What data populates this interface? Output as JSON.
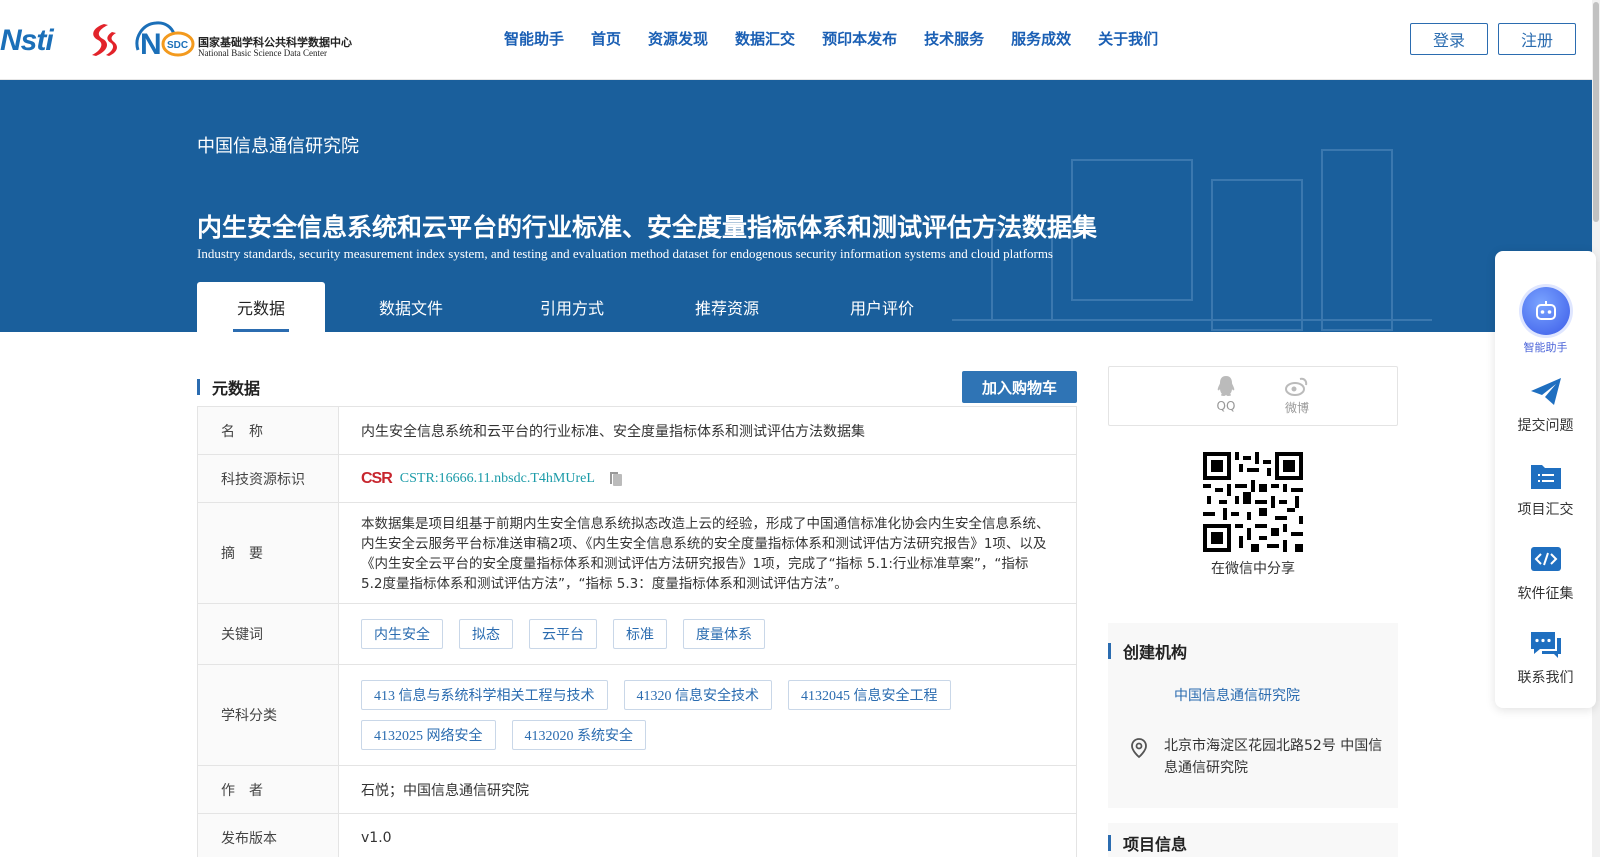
{
  "header": {
    "logo_nsti": "Nsti",
    "logo_nsdc_cn": "国家基础学科公共科学数据中心",
    "logo_nsdc_en": "National Basic Science Data Center",
    "logo_nsdc_mark": "NSDC",
    "nav": [
      "智能助手",
      "首页",
      "资源发现",
      "数据汇交",
      "预印本发布",
      "技术服务",
      "服务成效",
      "关于我们"
    ],
    "login_label": "登录",
    "register_label": "注册"
  },
  "banner": {
    "org": "中国信息通信研究院",
    "title": "内生安全信息系统和云平台的行业标准、安全度量指标体系和测试评估方法数据集",
    "subtitle": "Industry standards, security measurement index system, and testing and evaluation method dataset for endogenous security information systems and cloud platforms",
    "tabs": [
      "元数据",
      "数据文件",
      "引用方式",
      "推荐资源",
      "用户评价"
    ],
    "active_tab": "元数据"
  },
  "metadata": {
    "section_title": "元数据",
    "cart_label": "加入购物车",
    "labels": {
      "name": "名　称",
      "cstr": "科技资源标识",
      "abstract": "摘　要",
      "keywords": "关键词",
      "subjects": "学科分类",
      "author": "作　者",
      "version": "发布版本"
    },
    "name": "内生安全信息系统和云平台的行业标准、安全度量指标体系和测试评估方法数据集",
    "cstr_logo": "CSR",
    "cstr": "CSTR:16666.11.nbsdc.T4hMUreL",
    "abstract": "本数据集是项目组基于前期内生安全信息系统拟态改造上云的经验，形成了中国通信标准化协会内生安全信息系统、内生安全云服务平台标准送审稿2项、《内生安全信息系统的安全度量指标体系和测试评估方法研究报告》1项、以及《内生安全云平台的安全度量指标体系和测试评估方法研究报告》1项，完成了“指标 5.1:行业标准草案”，“指标 5.2度量指标体系和测试评估方法”，“指标 5.3：度量指标体系和测试评估方法”。",
    "keywords": [
      "内生安全",
      "拟态",
      "云平台",
      "标准",
      "度量体系"
    ],
    "subjects": [
      "413 信息与系统科学相关工程与技术",
      "41320 信息安全技术",
      "4132045 信息安全工程",
      "4132025 网络安全",
      "4132020 系统安全"
    ],
    "author": "石悦；中国信息通信研究院",
    "version": "v1.0"
  },
  "share": {
    "qq_label": "QQ",
    "weibo_label": "微博",
    "qr_caption": "在微信中分享"
  },
  "institution": {
    "title": "创建机构",
    "name": "中国信息通信研究院",
    "address": "北京市海淀区花园北路52号 中国信息通信研究院"
  },
  "project": {
    "title": "项目信息"
  },
  "float_panel": {
    "ai_label": "智能助手",
    "items": [
      "提交问题",
      "项目汇交",
      "软件征集",
      "联系我们"
    ]
  },
  "colors": {
    "brand_blue": "#2b6cb0",
    "banner_bg": "#1a5f9c",
    "cstr_red": "#c7262e",
    "cstr_link": "#1b9ba8"
  }
}
